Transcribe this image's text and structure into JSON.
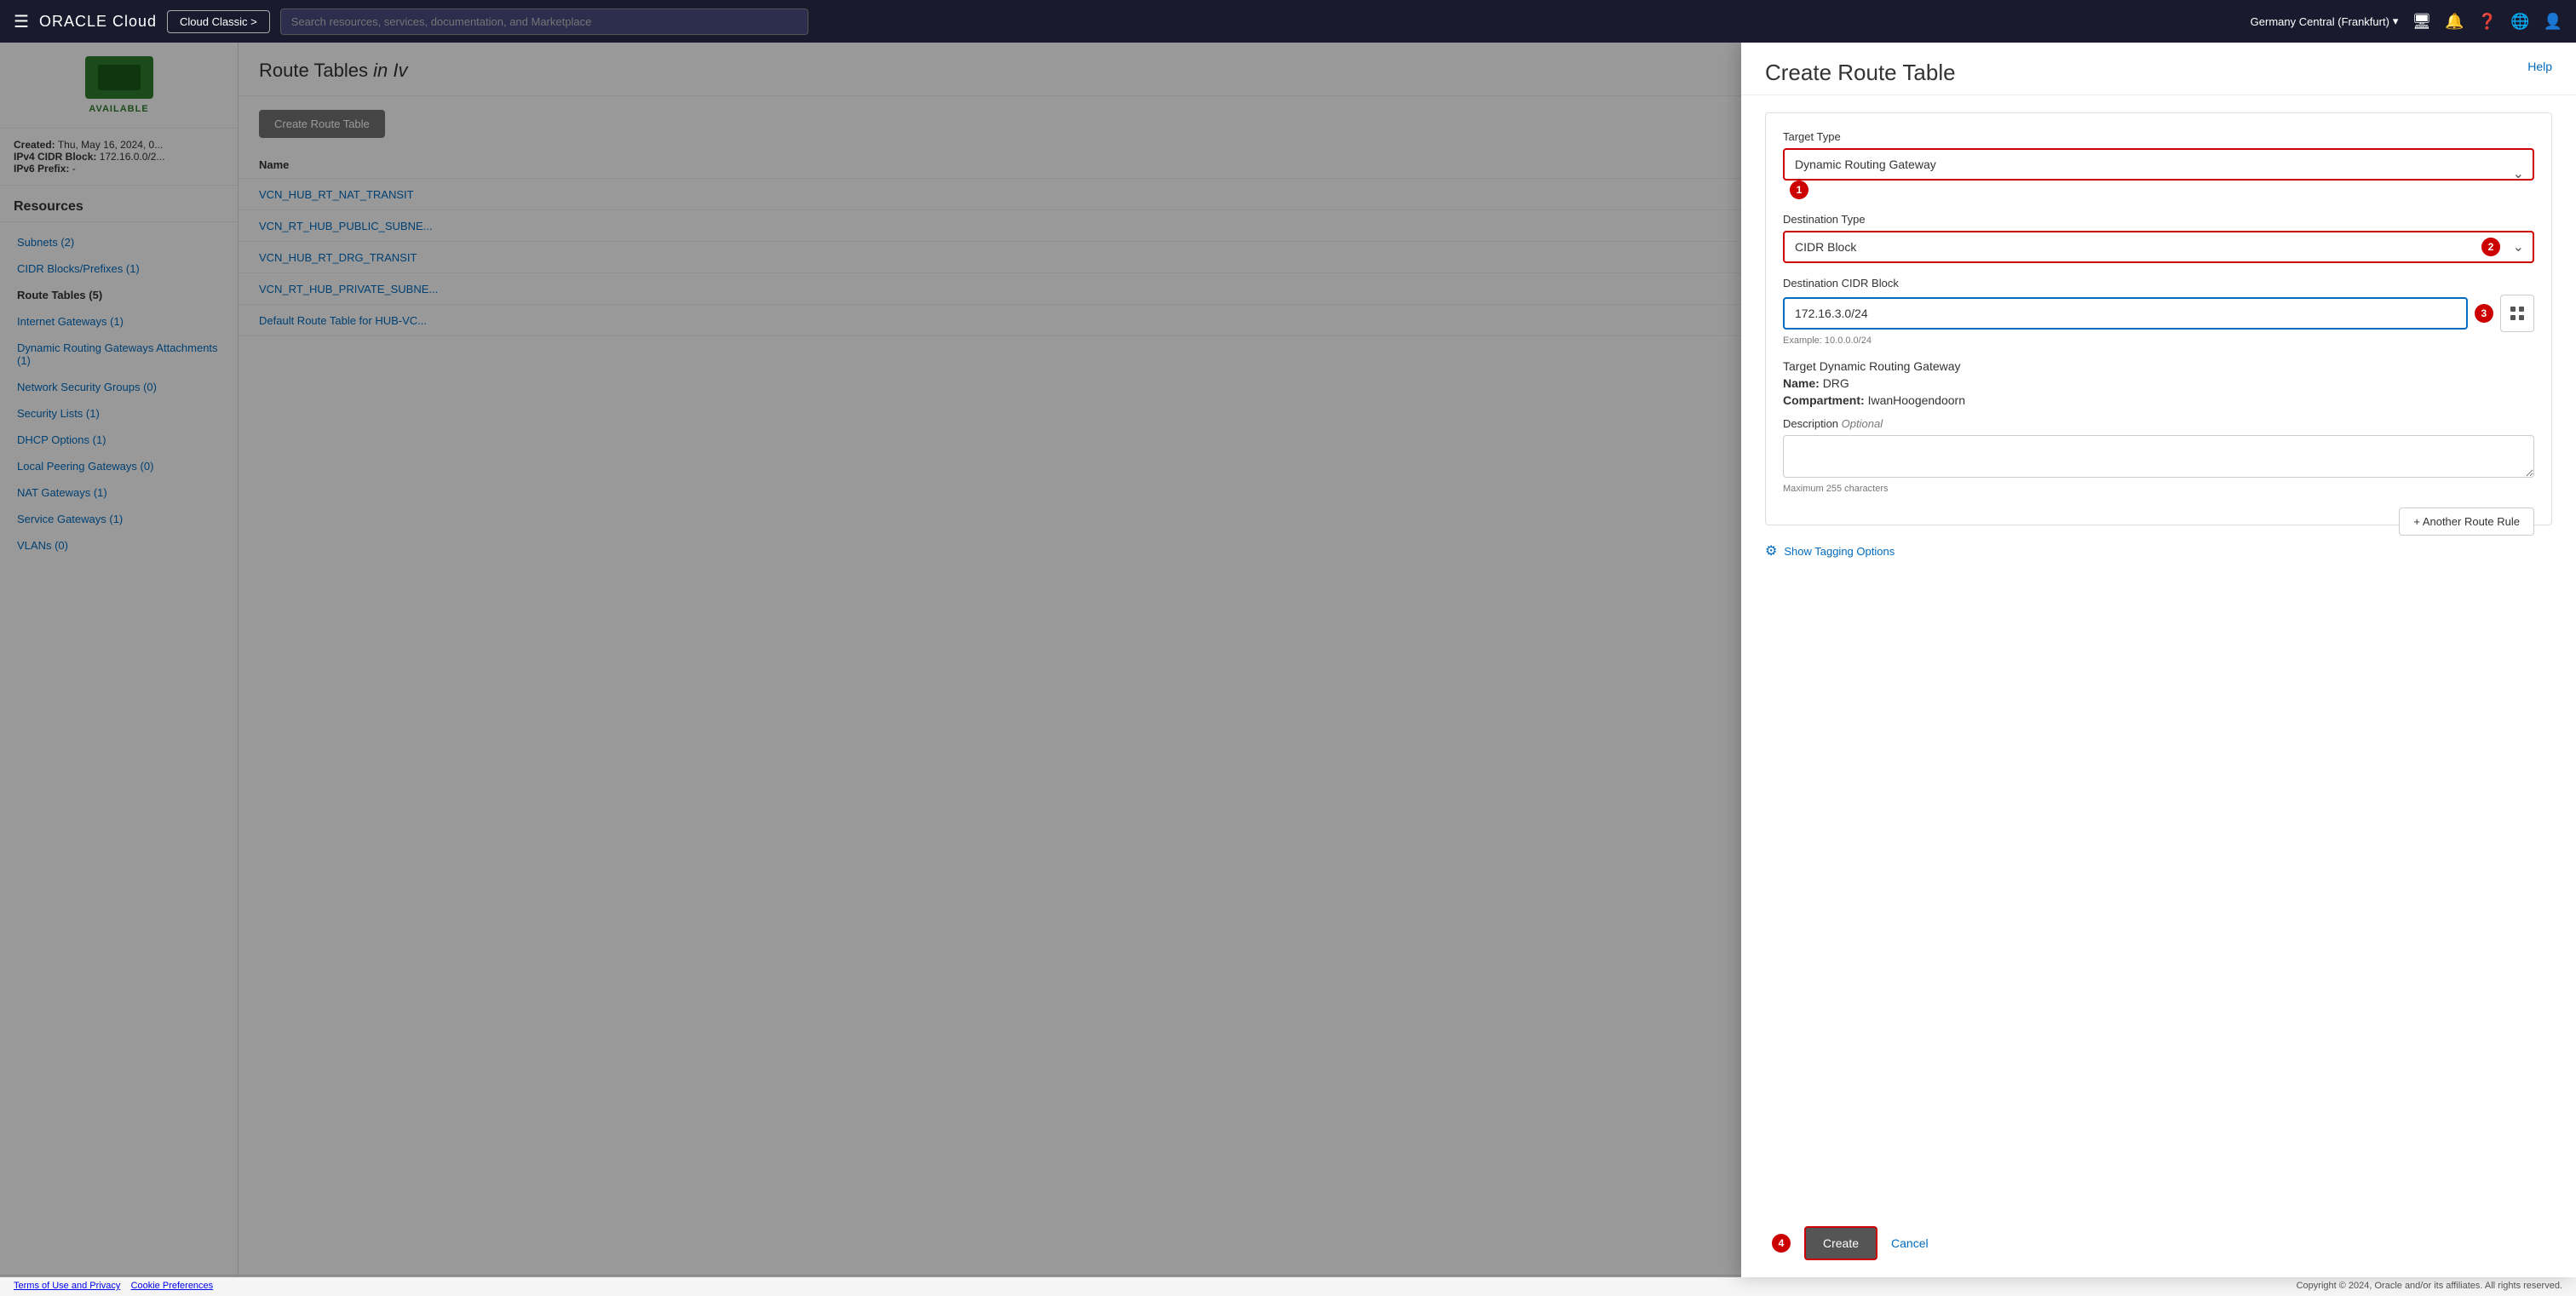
{
  "topnav": {
    "hamburger": "☰",
    "logo": "ORACLE Cloud",
    "cloud_classic": "Cloud Classic >",
    "search_placeholder": "Search resources, services, documentation, and Marketplace",
    "region": "Germany Central (Frankfurt)",
    "icons": [
      "monitor-icon",
      "bell-icon",
      "help-icon",
      "globe-icon",
      "user-icon"
    ]
  },
  "sidebar": {
    "status": "AVAILABLE",
    "created_label": "Created:",
    "created_value": "Thu, May 16, 2024, 0...",
    "ipv4_label": "IPv4 CIDR Block:",
    "ipv4_value": "172.16.0.0/2...",
    "ipv6_label": "IPv6 Prefix:",
    "ipv6_value": "-",
    "resources_heading": "Resources",
    "nav_items": [
      {
        "id": "subnets",
        "label": "Subnets (2)",
        "active": false
      },
      {
        "id": "cidr-blocks",
        "label": "CIDR Blocks/Prefixes (1)",
        "active": false
      },
      {
        "id": "route-tables",
        "label": "Route Tables (5)",
        "active": true
      },
      {
        "id": "internet-gateways",
        "label": "Internet Gateways (1)",
        "active": false
      },
      {
        "id": "drg-attachments",
        "label": "Dynamic Routing Gateways Attachments (1)",
        "active": false
      },
      {
        "id": "network-security-groups",
        "label": "Network Security Groups (0)",
        "active": false
      },
      {
        "id": "security-lists",
        "label": "Security Lists (1)",
        "active": false
      },
      {
        "id": "dhcp-options",
        "label": "DHCP Options (1)",
        "active": false
      },
      {
        "id": "local-peering",
        "label": "Local Peering Gateways (0)",
        "active": false
      },
      {
        "id": "nat-gateways",
        "label": "NAT Gateways (1)",
        "active": false
      },
      {
        "id": "service-gateways",
        "label": "Service Gateways (1)",
        "active": false
      },
      {
        "id": "vlans",
        "label": "VLANs (0)",
        "active": false
      }
    ]
  },
  "main_content": {
    "title_prefix": "Route Tables",
    "title_italic": "in Iv",
    "create_button": "Create Route Table",
    "table_header": "Name",
    "table_rows": [
      "VCN_HUB_RT_NAT_TRANSIT",
      "VCN_RT_HUB_PUBLIC_SUBNE...",
      "VCN_HUB_RT_DRG_TRANSIT",
      "VCN_RT_HUB_PRIVATE_SUBNE...",
      "Default Route Table for HUB-VC..."
    ]
  },
  "modal": {
    "title": "Create Route Table",
    "help_label": "Help",
    "target_type_label": "Target Type",
    "target_type_value": "Dynamic Routing Gateway",
    "step1_badge": "1",
    "destination_type_label": "Destination Type",
    "destination_type_value": "CIDR Block",
    "step2_badge": "2",
    "destination_cidr_label": "Destination CIDR Block",
    "destination_cidr_value": "172.16.3.0/24",
    "step3_badge": "3",
    "cidr_hint": "Example: 10.0.0.0/24",
    "target_drg_label": "Target Dynamic Routing Gateway",
    "target_name_label": "Name:",
    "target_name_value": "DRG",
    "target_compartment_label": "Compartment:",
    "target_compartment_value": "IwanHoogendoorn",
    "description_label": "Description",
    "optional_label": "Optional",
    "description_max": "Maximum 255 characters",
    "add_route_rule": "+ Another Route Rule",
    "show_tagging": "Show Tagging Options",
    "step4_badge": "4",
    "create_button": "Create",
    "cancel_button": "Cancel"
  },
  "footer": {
    "left_links": [
      "Terms of Use and Privacy",
      "Cookie Preferences"
    ],
    "right_text": "Copyright © 2024, Oracle and/or its affiliates. All rights reserved."
  }
}
